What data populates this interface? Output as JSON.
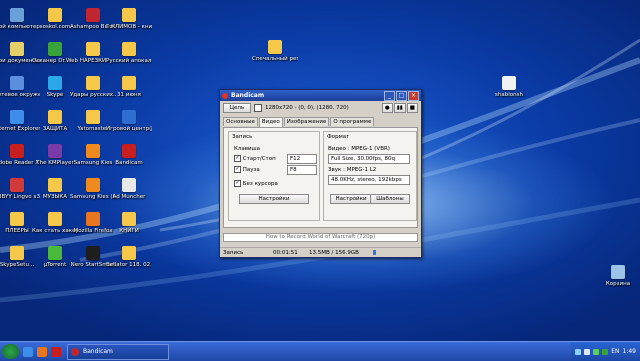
{
  "desktop_icons": [
    {
      "name": "icon-my-computer",
      "label": "Мой компьютер",
      "color": "#6aa0d8"
    },
    {
      "name": "icon-soskol",
      "label": "soskol.com",
      "color": "#f6c84a"
    },
    {
      "name": "icon-ashampoo",
      "label": "Ashampoo Burning Stu...",
      "color": "#c02630"
    },
    {
      "name": "icon-klimov-book",
      "label": "Г.КЛИМОВ - книги",
      "color": "#f6c84a"
    },
    {
      "name": "icon-my-documents",
      "label": "Мои документы",
      "color": "#e6d06a"
    },
    {
      "name": "icon-drweb",
      "label": "Осканер Dr.Web",
      "color": "#3aa23a"
    },
    {
      "name": "icon-narezki",
      "label": "НАРЕЗКИ",
      "color": "#f6c84a"
    },
    {
      "name": "icon-russian-apocalypse",
      "label": "Русский апокалипсис",
      "color": "#f6c84a"
    },
    {
      "name": "icon-network",
      "label": "Сетевое окружение",
      "color": "#5c8ee0"
    },
    {
      "name": "icon-skype",
      "label": "Skype",
      "color": "#2aa8e8"
    },
    {
      "name": "icon-udary",
      "label": "Удары русских...",
      "color": "#f6c84a"
    },
    {
      "name": "icon-31-june",
      "label": "31 июня",
      "color": "#f6c84a"
    },
    {
      "name": "icon-ie",
      "label": "Internet Explorer",
      "color": "#3c8ee8"
    },
    {
      "name": "icon-zaschita",
      "label": "ЗАЩИТА",
      "color": "#f6c84a"
    },
    {
      "name": "icon-yatomaster",
      "label": "Yatomaster",
      "color": "#f6c84a"
    },
    {
      "name": "icon-games",
      "label": "Игровой центр@Mail",
      "color": "#2d6ed0"
    },
    {
      "name": "icon-adobe-reader",
      "label": "Adobe Reader X",
      "color": "#c81e1e"
    },
    {
      "name": "icon-kmplayer",
      "label": "The KMPlayer",
      "color": "#7a3aa8"
    },
    {
      "name": "icon-samsung-kies",
      "label": "Samsung Kies",
      "color": "#f08a1e"
    },
    {
      "name": "icon-bandicam",
      "label": "Bandicam",
      "color": "#c81e1e"
    },
    {
      "name": "icon-abbyy",
      "label": "ABBYY Lingvo x3",
      "color": "#d23a3a"
    },
    {
      "name": "icon-muzyka",
      "label": "МУЗЫКА",
      "color": "#f6c84a"
    },
    {
      "name": "icon-samsung-kies-lite",
      "label": "Samsung Kies (Lite)",
      "color": "#f08a1e"
    },
    {
      "name": "icon-admuncher",
      "label": "Ad Muncher",
      "color": "#e8e8e8"
    },
    {
      "name": "icon-pleery",
      "label": "ПЛЕЕРЫ",
      "color": "#f6c84a"
    },
    {
      "name": "icon-hacker",
      "label": "Как стать хакером",
      "color": "#f6c84a"
    },
    {
      "name": "icon-firefox",
      "label": "Mozilla Firefox",
      "color": "#e8761e"
    },
    {
      "name": "icon-knigi",
      "label": "КНИГИ",
      "color": "#f6c84a"
    },
    {
      "name": "icon-skypesetup",
      "label": "SkypeSetu...",
      "color": "#f6c84a"
    },
    {
      "name": "icon-utorrent",
      "label": "µTorrent",
      "color": "#4ab83a"
    },
    {
      "name": "icon-nero",
      "label": "Nero StartSmart",
      "color": "#1e1e1e"
    },
    {
      "name": "icon-bellator",
      "label": "Bellator 118. 02.05.20...",
      "color": "#f6c84a"
    },
    {
      "name": "icon-reportazh",
      "label": "Спечальный репортаж",
      "color": "#f6c84a"
    },
    {
      "name": "icon-shablonsh",
      "label": "shablonsh",
      "color": "#f2f2f2"
    },
    {
      "name": "icon-recycle-bin",
      "label": "Корзина",
      "color": "#9cc4e8"
    }
  ],
  "window": {
    "title": "Bandicam",
    "target_button": "Цель",
    "target_text": "1280x720 - (0, 0), (1280, 720)",
    "tabs": [
      "Основные",
      "Видео",
      "Изображение",
      "О программе"
    ],
    "record_group": "Запись",
    "hotkey_label": "Клавиша",
    "start_stop": "Старт/Стоп",
    "start_stop_key": "F12",
    "pause": "Пауза",
    "pause_key": "F8",
    "no_cursor": "Без курсора",
    "settings_button": "Настройки",
    "format_group": "Формат",
    "video_format": "Видео : MPEG-1 (VBR)",
    "video_detail": "Full Size, 30.00fps, 80q",
    "audio_format": "Звук : MPEG-1 L2",
    "audio_detail": "48.0KHz, stereo, 192kbps",
    "format_settings_button": "Настройки",
    "templates_button": "Шаблоны",
    "title_box": "How to Record World of Warcraft (720p)",
    "status_label": "Запись",
    "status_time": "00:01:51",
    "status_size": "13.5MB / 156.9GB"
  },
  "taskbar": {
    "active_item": "Bandicam",
    "tray_lang": "EN",
    "clock": "1:49"
  },
  "colors": {
    "accent": "#1c3f9a",
    "desktop": "#0a3aa4"
  }
}
